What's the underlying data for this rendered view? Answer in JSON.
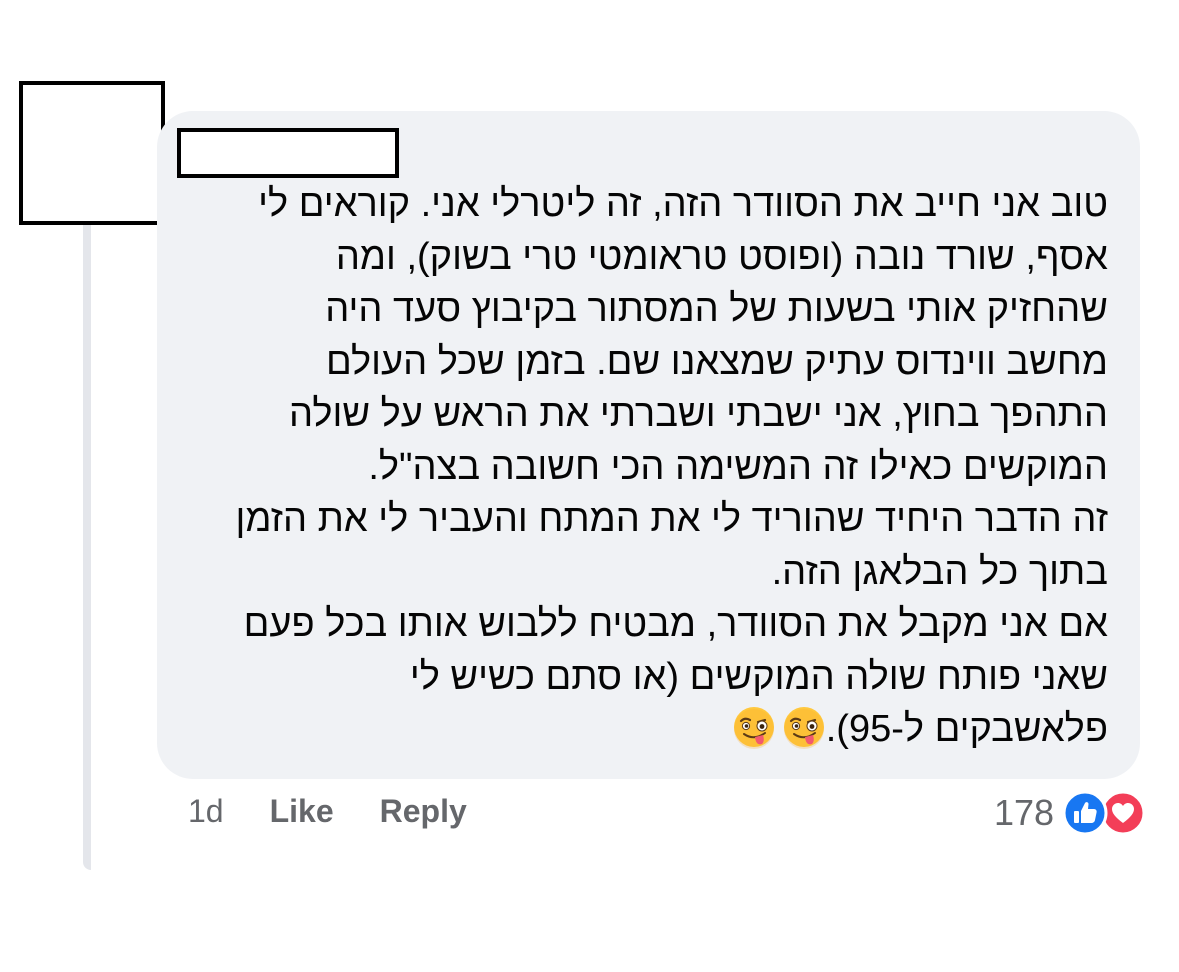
{
  "comment": {
    "lines": [
      "טוב אני חייב את הסוודר הזה, זה ליטרלי אני. קוראים לי",
      "אסף, שורד נובה (ופוסט טראומטי טרי בשוק), ומה",
      "שהחזיק אותי בשעות של המסתור בקיבוץ סעד היה",
      "מחשב ווינדוס עתיק שמצאנו שם. בזמן שכל העולם",
      "התהפך בחוץ, אני ישבתי ושברתי את הראש על שולה",
      "המוקשים כאילו זה המשימה הכי חשובה בצה\"ל.",
      "זה הדבר היחיד שהוריד לי את המתח והעביר לי את הזמן",
      "בתוך כל הבלאגן הזה.",
      "אם אני מקבל את הסוודר, מבטיח ללבוש אותו בכל פעם",
      "שאני פותח שולה המוקשים (או סתם כשיש לי",
      "פלאשבקים ל-95)."
    ],
    "emojis": [
      "winking-face-with-tongue",
      "winking-face-with-tongue"
    ]
  },
  "actions": {
    "time": "1d",
    "like_label": "Like",
    "reply_label": "Reply"
  },
  "reactions": {
    "count": "178",
    "types": [
      "like",
      "love"
    ],
    "colors": {
      "like": "#1877f2",
      "love": "#f33e58"
    }
  },
  "colors": {
    "bubble": "#f0f2f5",
    "text": "#050505",
    "secondary_text": "#65676b",
    "thread_line": "#e4e6eb"
  }
}
